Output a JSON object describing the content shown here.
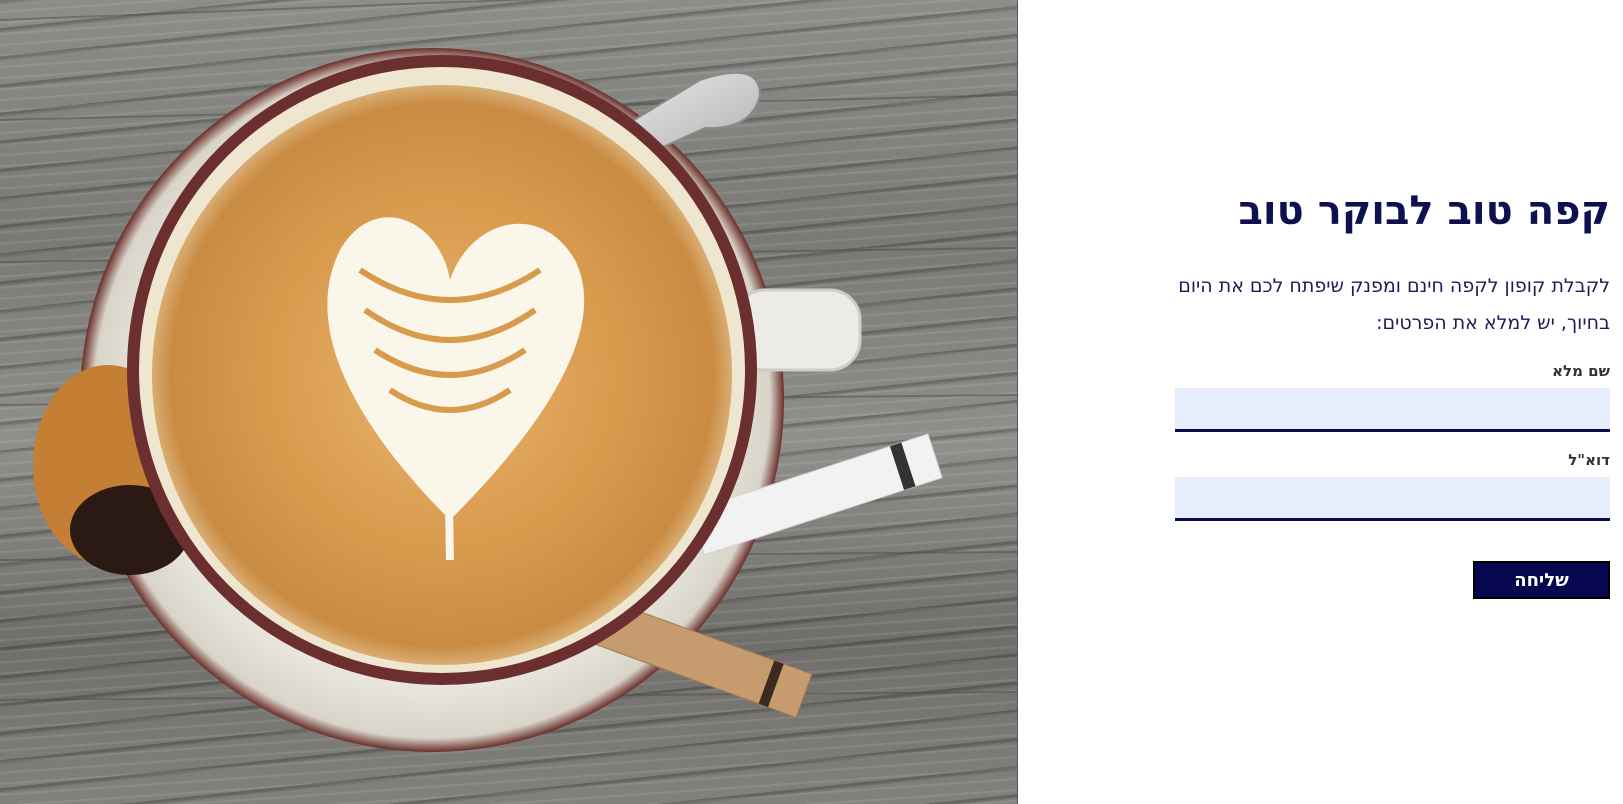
{
  "hero": {
    "image": "coffee-latte-art-photo",
    "background_color": "#85847f"
  },
  "form": {
    "title": "קפה טוב לבוקר טוב",
    "intro": "לקבלת קופון לקפה חינם ומפנק שיפתח לכם את היום בחיוך, יש למלא את הפרטים:",
    "name_label": "שם מלא",
    "name_value": "",
    "email_label": "דוא\"ל",
    "email_value": "",
    "submit_label": "שליחה"
  },
  "colors": {
    "title": "#0d1150",
    "field_background": "#e6edfd",
    "field_underline": "#080c4f",
    "button_background": "#06074e",
    "button_text": "#ffffff"
  }
}
